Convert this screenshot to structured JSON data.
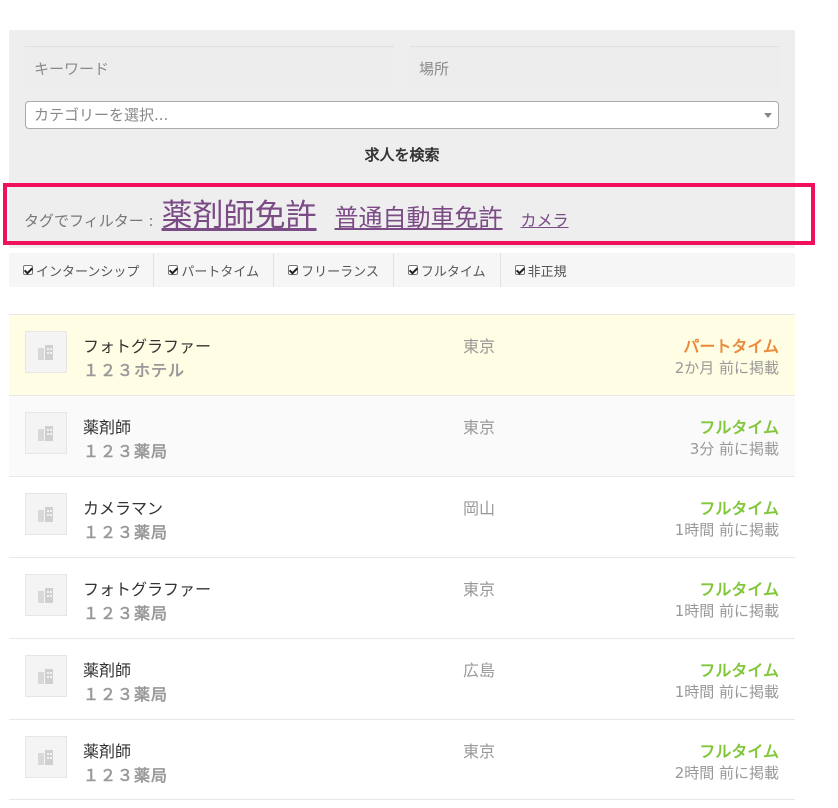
{
  "search": {
    "keyword_placeholder": "キーワード",
    "location_placeholder": "場所",
    "category_placeholder": "カテゴリーを選択...",
    "submit_label": "求人を検索"
  },
  "tag_filter": {
    "label": "タグでフィルター :",
    "tags": [
      "薬剤師免許",
      "普通自動車免許",
      "カメラ"
    ]
  },
  "job_types": [
    "インターンシップ",
    "パートタイム",
    "フリーランス",
    "フルタイム",
    "非正規"
  ],
  "jobs": [
    {
      "title": "フォトグラファー",
      "company": "１２３ホテル",
      "location": "東京",
      "type": "パートタイム",
      "posted": "2か月 前に掲載"
    },
    {
      "title": "薬剤師",
      "company": "１２３薬局",
      "location": "東京",
      "type": "フルタイム",
      "posted": "3分 前に掲載"
    },
    {
      "title": "カメラマン",
      "company": "１２３薬局",
      "location": "岡山",
      "type": "フルタイム",
      "posted": "1時間 前に掲載"
    },
    {
      "title": "フォトグラファー",
      "company": "１２３薬局",
      "location": "東京",
      "type": "フルタイム",
      "posted": "1時間 前に掲載"
    },
    {
      "title": "薬剤師",
      "company": "１２３薬局",
      "location": "広島",
      "type": "フルタイム",
      "posted": "1時間 前に掲載"
    },
    {
      "title": "薬剤師",
      "company": "１２３薬局",
      "location": "東京",
      "type": "フルタイム",
      "posted": "2時間 前に掲載"
    }
  ],
  "colors": {
    "highlight_border": "#f0105c",
    "tag_link": "#7a4b85",
    "part_time": "#ea8a3a",
    "full_time": "#82c73b",
    "featured_row_bg": "#fffde3"
  }
}
